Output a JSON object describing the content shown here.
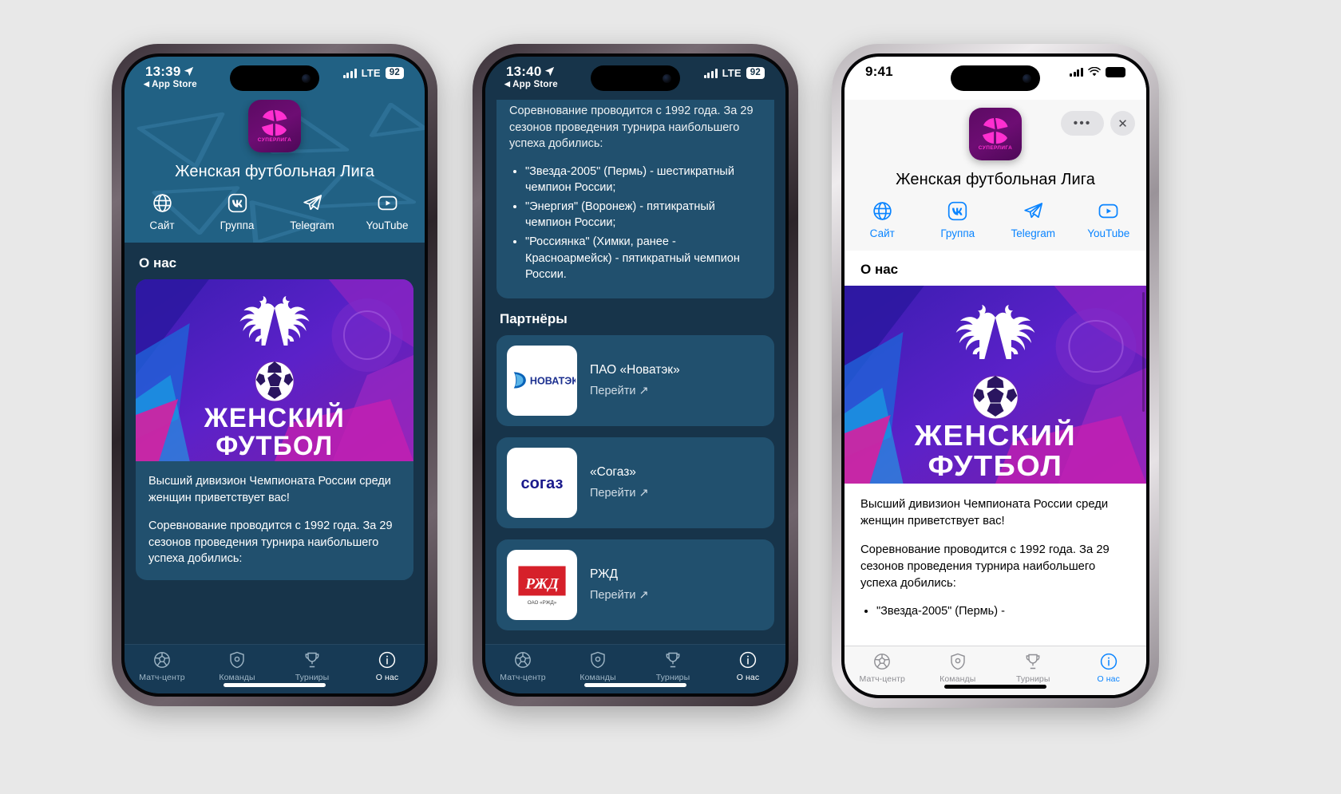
{
  "phones": [
    {
      "id": "phone-one",
      "theme": "dark",
      "status": {
        "time": "13:39",
        "back_label": "App Store",
        "carrier": "LTE",
        "battery": "92"
      },
      "header": {
        "app_icon_wordmark": "СУПЕРЛИГА",
        "title": "Женская футбольная Лига",
        "links": [
          {
            "icon": "globe-icon",
            "label": "Сайт"
          },
          {
            "icon": "vk-icon",
            "label": "Группа"
          },
          {
            "icon": "telegram-icon",
            "label": "Telegram"
          },
          {
            "icon": "youtube-icon",
            "label": "YouTube"
          }
        ]
      },
      "section_title": "О нас",
      "banner": {
        "line1": "ЖЕНСКИЙ",
        "line2": "ФУТБОЛ"
      },
      "body": {
        "paragraph_1": "Высший дивизион Чемпионата России среди женщин приветствует вас!",
        "paragraph_2": "Соревнование проводится с 1992 года. За 29 сезонов проведения турнира наибольшего успеха добились:"
      },
      "tabs": [
        {
          "icon": "ball-icon",
          "label": "Матч-центр",
          "active": false
        },
        {
          "icon": "shield-icon",
          "label": "Команды",
          "active": false
        },
        {
          "icon": "trophy-icon",
          "label": "Турниры",
          "active": false
        },
        {
          "icon": "info-icon",
          "label": "О нас",
          "active": true
        }
      ]
    },
    {
      "id": "phone-two",
      "theme": "dark",
      "status": {
        "time": "13:40",
        "back_label": "App Store",
        "carrier": "LTE",
        "battery": "92"
      },
      "body": {
        "paragraph_cut": "Соревнование проводится с 1992 года. За 29 сезонов проведения турнира наибольшего успеха добились:",
        "bullets": [
          "\"Звезда-2005\" (Пермь) - шестикратный чемпион России;",
          "\"Энергия\" (Воронеж) - пятикратный чемпион России;",
          "\"Россиянка\" (Химки, ранее - Красноармейск) - пятикратный чемпион России."
        ]
      },
      "partners_title": "Партнёры",
      "partners": [
        {
          "logo": "novatek-logo",
          "logo_text": "НОВАТЭК",
          "name": "ПАО «Новатэк»",
          "action": "Перейти ↗"
        },
        {
          "logo": "sogaz-logo",
          "logo_text": "согаз",
          "name": "«Согаз»",
          "action": "Перейти ↗"
        },
        {
          "logo": "rzd-logo",
          "logo_text": "РЖД",
          "logo_sub": "ОАО «РЖД»",
          "name": "РЖД",
          "action": "Перейти ↗"
        }
      ],
      "tabs": [
        {
          "icon": "ball-icon",
          "label": "Матч-центр",
          "active": false
        },
        {
          "icon": "shield-icon",
          "label": "Команды",
          "active": false
        },
        {
          "icon": "trophy-icon",
          "label": "Турниры",
          "active": false
        },
        {
          "icon": "info-icon",
          "label": "О нас",
          "active": true
        }
      ]
    },
    {
      "id": "phone-three",
      "theme": "light",
      "status": {
        "time": "9:41",
        "carrier": "",
        "battery": ""
      },
      "sheet_controls": {
        "more_label": "•••",
        "close_label": "✕"
      },
      "header": {
        "app_icon_wordmark": "СУПЕРЛИГА",
        "title": "Женская футбольная Лига",
        "links": [
          {
            "icon": "globe-icon",
            "label": "Сайт"
          },
          {
            "icon": "vk-icon",
            "label": "Группа"
          },
          {
            "icon": "telegram-icon",
            "label": "Telegram"
          },
          {
            "icon": "youtube-icon",
            "label": "YouTube"
          }
        ]
      },
      "section_title": "О нас",
      "banner": {
        "line1": "ЖЕНСКИЙ",
        "line2": "ФУТБОЛ"
      },
      "body": {
        "paragraph_1": "Высший дивизион Чемпионата России среди женщин приветствует вас!",
        "paragraph_2": "Соревнование проводится с 1992 года. За 29 сезонов проведения турнира наибольшего успеха добились:",
        "bullet_1": "\"Звезда-2005\" (Пермь) -"
      },
      "tabs": [
        {
          "icon": "ball-icon",
          "label": "Матч-центр",
          "active": false
        },
        {
          "icon": "shield-icon",
          "label": "Команды",
          "active": false
        },
        {
          "icon": "trophy-icon",
          "label": "Турниры",
          "active": false
        },
        {
          "icon": "info-icon",
          "label": "О нас",
          "active": true
        }
      ]
    }
  ],
  "colors": {
    "page_background": "#e8e8e8",
    "dark_app_background": "#17344a",
    "dark_card": "#21506e",
    "hero_blue": "#216184",
    "tabbar_dark": "#173a55",
    "accent_blue": "#0a84ff",
    "brand_magenta": "#ff2fd0",
    "brand_purple": "#5c0a63"
  }
}
